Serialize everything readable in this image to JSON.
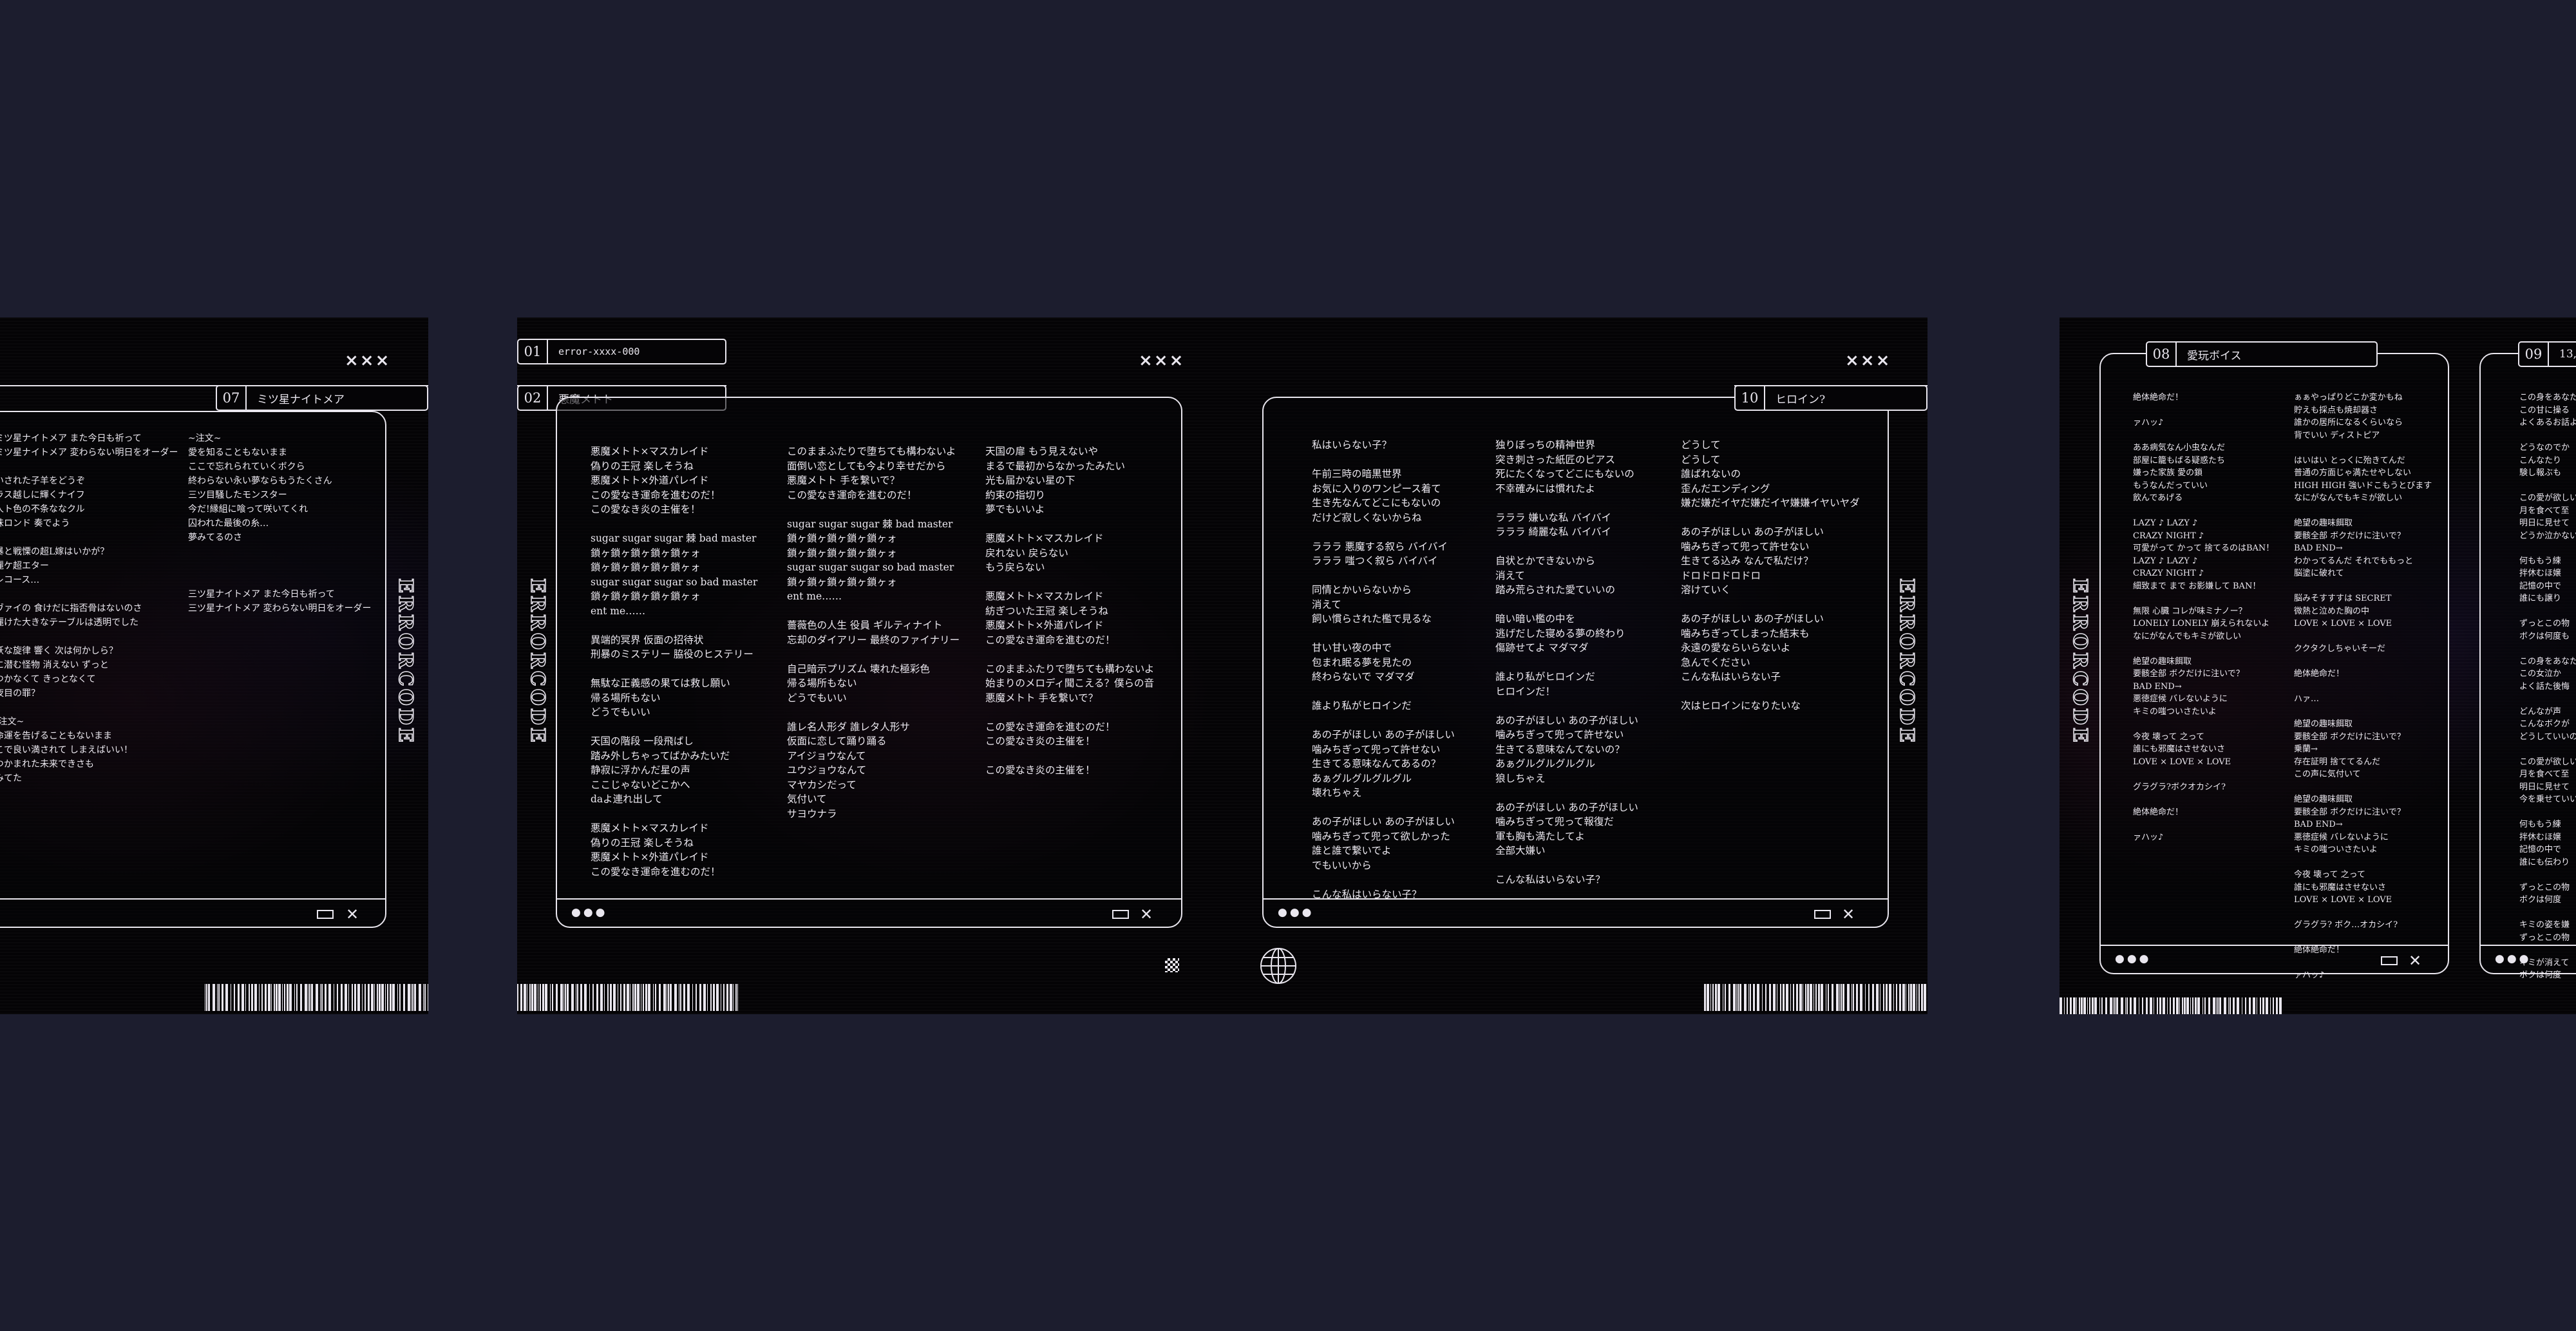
{
  "colors": {
    "background": "#1c1d2e",
    "card": "#040305",
    "line": "#e9e6ee"
  },
  "brand": "ERRORCODE",
  "close_marks": "×××",
  "window_controls": {
    "dots": "●●●",
    "maximize": "☐",
    "close": "✕"
  },
  "icons": [
    "globe-icon",
    "checker-icon",
    "barcode"
  ],
  "card1": {
    "track": {
      "number": "07",
      "title": "ミツ星ナイトメア"
    },
    "columns": [
      "ミツ星ナイトメア また今日も祈って\nミツ星ナイトメア 変わらない明日をオーダー\n\nいされた子羊をどうぞ\nラス越しに輝くナイフ\n人ト色の不条ななクル\n味ロンド 奏でよう\n\n暴と戦慄の超L嫁はいかが？\n麗ケ超エター\nレコース…\n\nヴァイの 食けだに指否骨はないのさ\n麗けた大きなテーブルは透明でした\n\n妖な旋律 響く 次は何かしら？\nに潜む怪物 消えない ずっと\nつかなくて きっとなくて\n夜目の罪？\n\nI注文~\n命運を告げることもないまま\nこで良い満されて しまえばいい！\nつかまれた未来できさも\nみてた",
      "~注文~\n愛を知ることもないまま\nここで忘れられていくボクら\n終わらない永い夢ならもうたくさん\n三ツ目騒したモンスター\n今だ!縁組に喰って咲いてくれ\n囚われた最後の糸…\n夢みてるのさ\n\n\n\n三ツ星ナイトメア また今日も祈って\n三ツ星ナイトメア 変わらない明日をオーダー"
    ]
  },
  "card2": {
    "tracks": [
      {
        "number": "01",
        "title": "error-xxxx-000"
      },
      {
        "number": "02",
        "title": "悪魔メトト"
      },
      {
        "number": "10",
        "title": "ヒロイン?"
      }
    ],
    "columns": [
      "悪魔メトト×マスカレイド\n偽りの王冠 楽しそうね\n悪魔メトト×外道パレイド\nこの愛なき運命を進むのだ！\nこの愛なき炎の主催を！\n\nsugar sugar sugar 棘 bad master\n鎖ヶ鎖ヶ鎖ヶ鎖ヶ鎖ヶォ\n鎖ヶ鎖ヶ鎖ヶ鎖ヶ鎖ヶォ\nsugar sugar sugar so bad master\n鎖ヶ鎖ヶ鎖ヶ鎖ヶ鎖ヶォ\nent me……\n\n異端的冥界 仮面の招待状\n刑暴のミステリー 脇役のヒステリー\n\n無駄な正義感の果ては救し願い\n帰る場所もない\nどうでもいい\n\n天国の階段 一段飛ばし\n踏み外しちゃってばかみたいだ\n静寂に浮かんだ星の声\nここじゃないどこかへ\ndaよ連れ出して\n\n悪魔メトト×マスカレイド\n偽りの王冠 楽しそうね\n悪魔メトト×外道パレイド\nこの愛なき運命を進むのだ！",
      "このままふたりで堕ちても構わないよ\n面倒い恋としても今より幸せだから\n悪魔メトト 手を繋いで？\nこの愛なき運命を進むのだ！\n\nsugar sugar sugar 棘 bad master\n鎖ヶ鎖ヶ鎖ヶ鎖ヶ鎖ヶォ\n鎖ヶ鎖ヶ鎖ヶ鎖ヶ鎖ヶォ\nsugar sugar sugar so bad master\n鎖ヶ鎖ヶ鎖ヶ鎖ヶ鎖ヶォ\nent me……\n\n薔薇色の人生 役員 ギルティナイト\n忘却のダイアリー 最終のファイナリー\n\n自己暗示プリズム 壊れた極彩色\n帰る場所もない\nどうでもいい\n\n誰レ名人形ダ 誰レタ人形サ\n仮面に恋して踊り踊る\nアイジョウなんて\nユウジョウなんて\nマヤカシだって\n気付いて\nサヨウナラ",
      "天国の扉 もう見えないや\nまるで最初からなかったみたい\n光も届かない星の下\n約束の指切り\n夢でもいいよ\n\n悪魔メトト×マスカレイド\n戻れない 戻らない\nもう戻らない\n\n悪魔メトト×マスカレイド\n紡ぎついた王冠 楽しそうね\n悪魔メトト×外道パレイド\nこの愛なき運命を進むのだ！\n\nこのままふたりで堕ちても構わないよ\n始まりのメロディ聞こえる？僕らの音\n悪魔メトト 手を繋いで？\n\nこの愛なき運命を進むのだ！\nこの愛なき炎の主催を！\n\nこの愛なき炎の主催を！",
      "私はいらない子？\n\n午前三時の暗黒世界\nお気に入りのワンピース着て\n生き先なんてどこにもないの\nだけど寂しくないからね\n\nラララ 悪魔する叙ら バイバイ\nラララ 嗤つく叙ら バイバイ\n\n同情とかいらないから\n消えて\n飼い慣らされた檻で見るな\n\n甘い甘い夜の中で\n包まれ眠る夢を見たの\n終わらないで マダマダ\n\n誰より私がヒロインだ\n\nあの子がほしい あの子がほしい\n噛みちぎって兜って許せない\n生きてる意味なんてあるの？\nあぁグルグルグルグル\n壊れちゃえ\n\nあの子がほしい あの子がほしい\n噛みちぎって兜って欲しかった\n誰と誰で繋いでよ\nでもいいから\n\nこんな私はいらない子？",
      "独りぼっちの精神世界\n突き刺さった紙匠のピアス\n死にたくなってどこにもないの\n不幸確みには慣れたよ\n\nラララ 嫌いな私 バイバイ\nラララ 綺麗な私 バイバイ\n\n自状とかできないから\n消えて\n踏み荒らされた愛ていいの\n\n暗い暗い檻の中を\n逃げだした寝める夢の終わり\n傷跡せてよ マダマダ\n\n誰より私がヒロインだ\nヒロインだ！\n\nあの子がほしい あの子がほしい\n噛みちぎって兜って許せない\n生きてる意味なんてないの？\nあぁグルグルグルグル\n狼しちゃえ\n\nあの子がほしい あの子がほしい\n噛みちぎって兜って報復だ\n軍も胸も満たしてよ\n全部大嫌い\n\nこんな私はいらない子？",
      "どうして\nどうして\n誰ばれないの\n歪んだエンディング\n嫌だ嫌だイヤだ嫌だイヤ嫌嫌イヤいヤダ\n\nあの子がほしい あの子がほしい\n噛みちぎって兜って許せない\n生きてる込み なんで私だけ？\nドロドロドロドロ\n溶けていく\n\nあの子がほしい あの子がほしい\n噛みちぎってしまった結末も\n永遠の愛ならいらないよ\n急んでください\nこんな私はいらない子\n\n次はヒロインになりたいな"
    ]
  },
  "card3": {
    "tracks": [
      {
        "number": "08",
        "title": "愛玩ボイス"
      },
      {
        "number": "09",
        "title": "13,"
      }
    ],
    "columns": [
      "絶体絶命だ！\n\nァハッ♪\n\nああ病気なん小虫なんだ\n部屋に籠もばる疑惑たち\n嫌った家族 愛の鎖\nもうなんだっていい\n飲んであげる\n\nLAZY ♪ LAZY ♪\nCRAZY NIGHT ♪\n可愛がって かって 捨てるのはBAN！\nLAZY ♪ LAZY ♪\nCRAZY NIGHT ♪\n細致まで まで お影嫌して BAN！\n\n無限 心臓 コレが味ミナノー？\nLONELY LONELY 崩えられないよ\nなにがなんでもキミが欲しい\n\n絶望の趣味餌取\n要骸全部 ボクだけに注いで？\nBAD END→\n悪徳症候 バレないように\nキミの嗤ついさたいよ\n\n今夜 壊って 之って\n誰にも邪魔はさせないさ\nLOVE × LOVE × LOVE\n\nグラグラ?ボクオカシイ?\n\n絶体絶命だ！\n\nァハッ♪",
      "ぁぁやっぱりどこか変かもね\n貯えも採点も焼却器さ\n誰かの居所になるくらいなら\n背でいい ディストピア\n\nはいはい とっくに殆きてんだ\n普通の方面じゃ満たせやしない\nHIGH HIGH 強いドこもうとびます\nなにがなんでもキミが欲しい\n\n絶望の趣味餌取\n要骸全部 ボクだけに注いで？\nBAD END→\nわかってるんだ それでももっと\n脳塗に破れて\n\n脳みそすすすは SECRET\n微熱と泣めた胸の中\nLOVE × LOVE × LOVE\n\nククタクしちゃいそーだ\n\n絶体絶命だ！\n\nハァ…\n\n絶望の趣味餌取\n要骸全部 ボクだけに注いで？\n乗蘭→\n存在証明 捨ててるんだ\nこの声に気付いて\n\n絶望の趣味餌取\n要骸全部 ボクだけに注いで？\nBAD END→\n悪徳症候 バレないように\nキミの嗤ついさたいよ\n\n今夜 壊って 之って\n誰にも邪魔はさせないさ\nLOVE × LOVE × LOVE\n\nグラグラ? ボク…オカシイ?\n\n絶体絶命だ！\n\nァハッ♪",
      "この身をあなた\nこの甘に操る\nよくあるお話よ\n\nどうなのでか\nこんなたり\n験し報ぶも\n\nこの愛が欲しい\n月を食べて至\n明日に見せて\nどうか泣かない\n\n何ももう練\n拌休むほ嬢\n記憶の中で\n誰にも譲り\n\nずっとこの物\nボクは何度も\n\nこの身をあなた\nこの女泣か\nよく話た後悔\n\nどんなが声\nこんなボクが\nどうしていいの\n\nこの愛が欲しい\n月を食べて至\n明日に見せて\n今を乗せていい\n\n何ももう練\n拌休むほ嬢\n記憶の中で\n誰にも伝わり\n\nずっとこの物\nボクは何度\n\nキミの姿を嫌\nずっとこの物\n\nキミが消えて\nボクは何度"
    ]
  }
}
